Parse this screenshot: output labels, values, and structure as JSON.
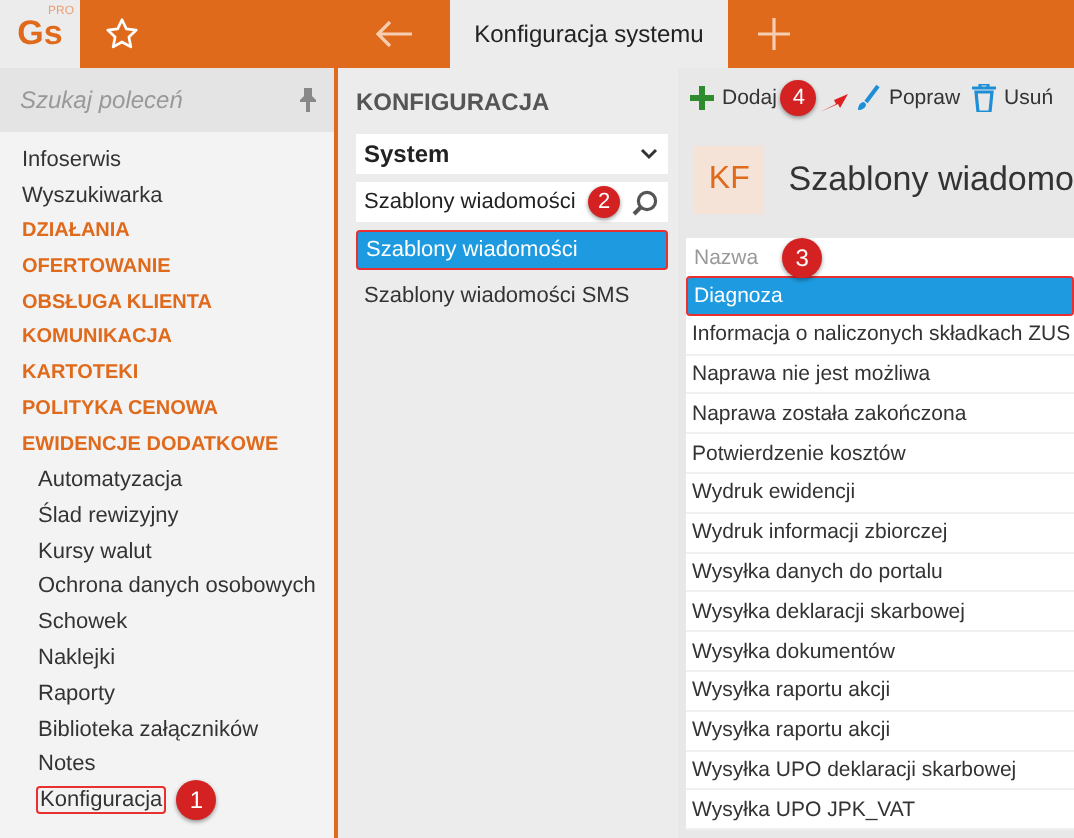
{
  "app": {
    "logo": "Gs",
    "logo_badge": "PRO"
  },
  "tab_bar": {
    "active_tab": "Konfiguracja systemu"
  },
  "sidebar": {
    "search": {
      "placeholder": "Szukaj poleceń"
    },
    "items": [
      {
        "kind": "item",
        "label": "Infoserwis"
      },
      {
        "kind": "item",
        "label": "Wyszukiwarka"
      },
      {
        "kind": "section",
        "label": "DZIAŁANIA"
      },
      {
        "kind": "section",
        "label": "OFERTOWANIE"
      },
      {
        "kind": "section",
        "label": "OBSŁUGA KLIENTA"
      },
      {
        "kind": "section",
        "label": "KOMUNIKACJA"
      },
      {
        "kind": "section",
        "label": "KARTOTEKI"
      },
      {
        "kind": "section",
        "label": "POLITYKA CENOWA"
      },
      {
        "kind": "section",
        "label": "EWIDENCJE DODATKOWE"
      },
      {
        "kind": "subitem",
        "label": "Automatyzacja"
      },
      {
        "kind": "subitem",
        "label": "Ślad rewizyjny"
      },
      {
        "kind": "subitem",
        "label": "Kursy walut"
      },
      {
        "kind": "subitem",
        "label": "Ochrona danych osobowych"
      },
      {
        "kind": "subitem",
        "label": "Schowek"
      },
      {
        "kind": "subitem",
        "label": "Naklejki"
      },
      {
        "kind": "subitem",
        "label": "Raporty"
      },
      {
        "kind": "subitem",
        "label": "Biblioteka załączników"
      },
      {
        "kind": "subitem",
        "label": "Notes"
      },
      {
        "kind": "subitem",
        "label": "Konfiguracja",
        "selected": true,
        "callout": "1"
      }
    ]
  },
  "config_panel": {
    "heading": "KONFIGURACJA",
    "category": "System",
    "search": {
      "value": "Szablony wiadomości",
      "callout": "2"
    },
    "items": [
      {
        "label": "Szablony wiadomości",
        "selected": true
      },
      {
        "label": "Szablony wiadomości SMS",
        "selected": false
      }
    ]
  },
  "toolbar": {
    "buttons": [
      {
        "kind": "add",
        "label": "Dodaj",
        "callout": "4"
      },
      {
        "kind": "edit",
        "label": "Popraw"
      },
      {
        "kind": "delete",
        "label": "Usuń"
      }
    ]
  },
  "detail": {
    "avatar": "KF",
    "title": "Szablony wiadomo",
    "table": {
      "columns": [
        {
          "label": "Nazwa",
          "callout": "3"
        }
      ],
      "rows": [
        {
          "name": "Diagnoza",
          "selected": true
        },
        {
          "name": "Informacja o naliczonych składkach ZUS",
          "selected": false
        },
        {
          "name": "Naprawa nie jest możliwa",
          "selected": false
        },
        {
          "name": "Naprawa została zakończona",
          "selected": false
        },
        {
          "name": "Potwierdzenie kosztów",
          "selected": false
        },
        {
          "name": "Wydruk ewidencji",
          "selected": false
        },
        {
          "name": "Wydruk informacji zbiorczej",
          "selected": false
        },
        {
          "name": "Wysyłka danych do portalu",
          "selected": false
        },
        {
          "name": "Wysyłka deklaracji skarbowej",
          "selected": false
        },
        {
          "name": "Wysyłka dokumentów",
          "selected": false
        },
        {
          "name": "Wysyłka raportu akcji",
          "selected": false
        },
        {
          "name": "Wysyłka raportu akcji",
          "selected": false
        },
        {
          "name": "Wysyłka UPO deklaracji skarbowej",
          "selected": false
        },
        {
          "name": "Wysyłka UPO JPK_VAT",
          "selected": false
        }
      ]
    }
  }
}
